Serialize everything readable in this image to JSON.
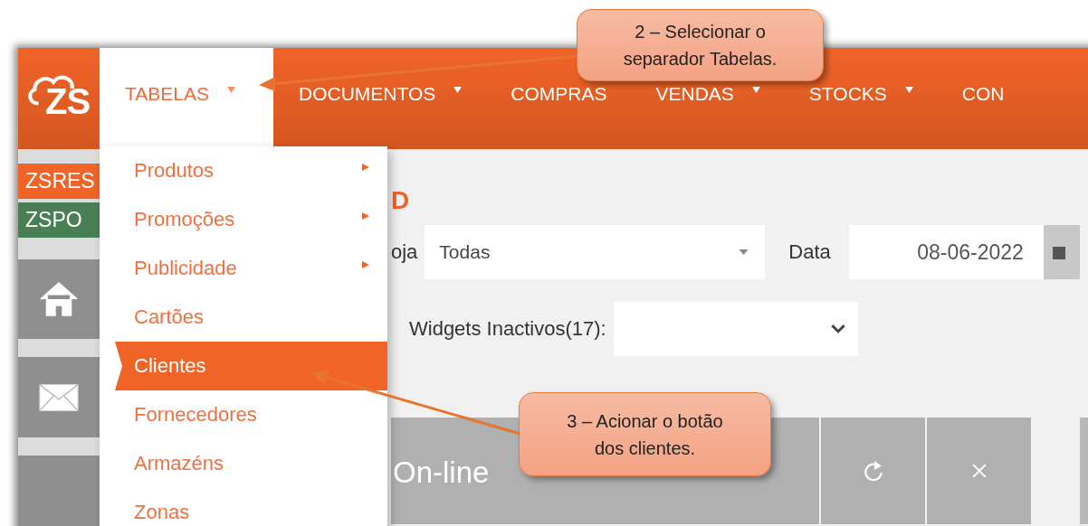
{
  "logo": {
    "text": "ZS"
  },
  "nav": {
    "items": [
      {
        "label": "TABELAS",
        "selected": true,
        "caret": true
      },
      {
        "label": "DOCUMENTOS",
        "selected": false,
        "caret": true
      },
      {
        "label": "COMPRAS",
        "selected": false,
        "caret": false
      },
      {
        "label": "VENDAS",
        "selected": false,
        "caret": true
      },
      {
        "label": "STOCKS",
        "selected": false,
        "caret": true
      },
      {
        "label": "CON",
        "selected": false,
        "caret": false
      }
    ]
  },
  "sidebar": {
    "badges": [
      {
        "label": "ZSRES",
        "color": "#f06428"
      },
      {
        "label": "ZSPO",
        "color": "#4a7f55"
      }
    ],
    "tiles": [
      {
        "kind": "home"
      },
      {
        "kind": "mail"
      },
      {
        "kind": "empty"
      }
    ]
  },
  "menu": {
    "items": [
      {
        "label": "Produtos",
        "selected": false,
        "submenu": true
      },
      {
        "label": "Promoções",
        "selected": false,
        "submenu": true
      },
      {
        "label": "Publicidade",
        "selected": false,
        "submenu": true
      },
      {
        "label": "Cartões",
        "selected": false,
        "submenu": false
      },
      {
        "label": "Clientes",
        "selected": true,
        "submenu": false
      },
      {
        "label": "Fornecedores",
        "selected": false,
        "submenu": false
      },
      {
        "label": "Armazéns",
        "selected": false,
        "submenu": false
      },
      {
        "label": "Zonas",
        "selected": false,
        "submenu": false
      }
    ]
  },
  "dashboard": {
    "title": "D",
    "store_label": "oja",
    "store_value": "Todas",
    "date_label": "Data",
    "date_value": "08-06-2022",
    "widgets_label": "Widgets Inactivos(17):",
    "panel": {
      "title": "On-line"
    }
  },
  "callouts": [
    {
      "text": "2 – Selecionar o separador Tabelas."
    },
    {
      "text": "3 – Acionar o botão dos clientes."
    }
  ]
}
